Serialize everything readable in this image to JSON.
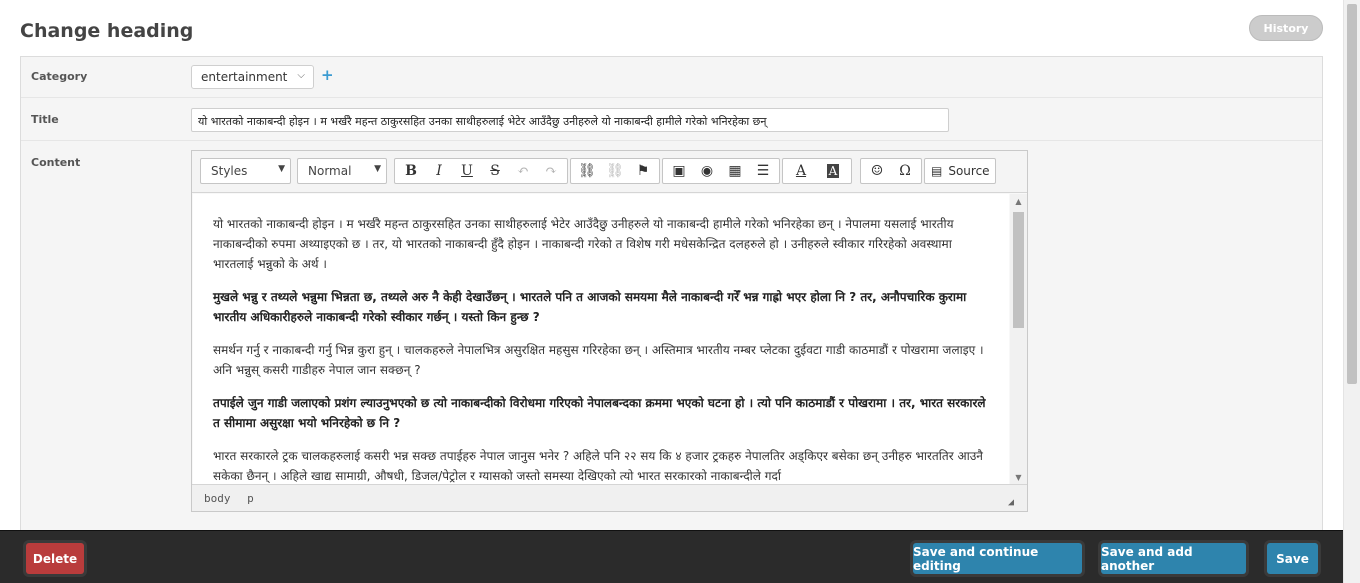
{
  "page": {
    "title": "Change heading",
    "history_label": "History"
  },
  "fields": {
    "category_label": "Category",
    "category_value": "entertainment",
    "add_label": "+",
    "title_label": "Title",
    "title_value": "यो भारतको नाकाबन्दी होइन । म भर्खरै महन्त ठाकुरसहित उनका साथीहरुलाई भेटेर आउँदैछु उनीहरुले यो नाकाबन्दी हामीले गरेको भनिरहेका छन्",
    "content_label": "Content"
  },
  "editor": {
    "styles_label": "Styles",
    "format_label": "Normal",
    "source_label": "Source",
    "icons": {
      "bold": "B",
      "italic": "I",
      "underline": "U",
      "strike": "S",
      "undo": "↶",
      "redo": "↷",
      "link": "⛓",
      "unlink": "⛓",
      "anchor": "⚑",
      "image": "▣",
      "flash": "◉",
      "table": "▦",
      "hr": "☰",
      "text_color": "A",
      "bg_color": "A",
      "smiley": "☺",
      "special_char": "Ω",
      "source": "▤"
    },
    "paragraphs": [
      {
        "bold": false,
        "text": "यो भारतको नाकाबन्दी होइन । म भर्खरै महन्त ठाकुरसहित उनका साथीहरुलाई भेटेर आउँदैछु उनीहरुले यो नाकाबन्दी हामीले गरेको भनिरहेका छन् । नेपालमा यसलाई भारतीय नाकाबन्दीको रुपमा अथ्याइएको छ । तर, यो भारतको नाकाबन्दी हुँदै होइन । नाकाबन्दी गरेको त विशेष गरी मधेसकेन्द्रित दलहरुले हो । उनीहरुले स्वीकार गरिरहेको अवस्थामा भारतलाई भन्नुको के अर्थ ।"
      },
      {
        "bold": true,
        "text": "मुखले भन्नु र तथ्यले भन्नुमा भिन्नता छ, तथ्यले अरु नै केही देखाउँछन् । भारतले पनि त आजको समयमा मैले नाकाबन्दी गरेँ भन्न गाह्रो भएर होला नि ? तर, अनौपचारिक कुरामा भारतीय अधिकारीहरुले नाकाबन्दी गरेको स्वीकार गर्छन् । यस्तो किन हुन्छ ?"
      },
      {
        "bold": false,
        "text": "समर्थन गर्नु र नाकाबन्दी गर्नु भिन्न कुरा हुन् । चालकहरुले नेपालभित्र असुरक्षित महसुस गरिरहेका छन् । अस्तिमात्र भारतीय नम्बर प्लेटका दुईवटा गाडी काठमाडौं र पोखरामा जलाइए । अनि भन्नुस् कसरी गाडीहरु नेपाल जान सक्छन् ?"
      },
      {
        "bold": true,
        "text": "तपाईले जुन गाडी जलाएको प्रशंग ल्याउनुभएको छ त्यो नाकाबन्दीको विरोधमा गरिएको नेपालबन्दका क्रममा भएको घटना हो । त्यो पनि काठमाडौं र पोखरामा । तर, भारत सरकारले त सीमामा असुरक्षा भयो भनिरहेको छ नि ?"
      },
      {
        "bold": false,
        "text": "भारत सरकारले ट्रक चालकहरुलाई कसरी भन्न सक्छ तपाईहरु नेपाल जानुस भनेर ? अहिले पनि २२ सय कि ४ हजार ट्रकहरु नेपालतिर अड्किएर बसेका छन् उनीहरु भारततिर आउनै सकेका छैनन् । अहिले खाद्य सामाग्री, औषधी, डिजल/पेट्रोल र ग्यासको जस्तो समस्या देखिएको त्यो भारत सरकारको नाकाबन्दीले गर्दा"
      }
    ],
    "path": [
      "body",
      "p"
    ]
  },
  "footer": {
    "delete_label": "Delete",
    "save_continue_label": "Save and continue editing",
    "save_add_label": "Save and add another",
    "save_label": "Save"
  }
}
